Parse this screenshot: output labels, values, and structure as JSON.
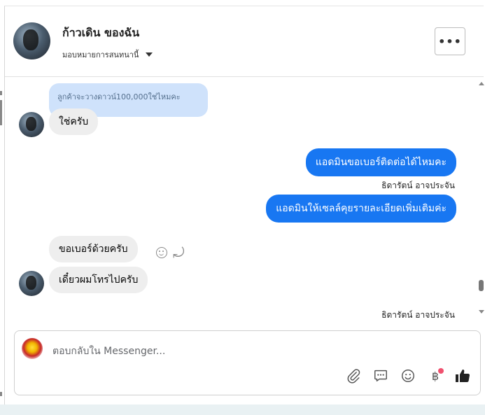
{
  "header": {
    "title": "ก้าวเดิน ของฉัน",
    "assign_label": "มอบหมายการสนทนานี้",
    "more_label": "•••"
  },
  "conversation": {
    "quoted_text": "ลูกค้าจะวางดาวน์100,000ใช่ไหมคะ",
    "messages": [
      {
        "direction": "incoming",
        "text": "ใช่ครับ"
      },
      {
        "direction": "outgoing",
        "text": "แอดมินขอเบอร์ติดต่อได้ไหมคะ"
      },
      {
        "direction": "outgoing",
        "text": "แอดมินให้เซลล์คุยรายละเอียดเพิ่มเติมค่ะ"
      },
      {
        "direction": "incoming",
        "text": "ขอเบอร์ด้วยครับ"
      },
      {
        "direction": "incoming",
        "text": "เดี๋ยวผมโทรไปครับ"
      }
    ],
    "sender_name_1": "ธิดารัตน์ อาจประจัน",
    "sender_name_2": "ธิดารัตน์ อาจประจัน"
  },
  "composer": {
    "placeholder": "ตอบกลับใน Messenger...",
    "baht_symbol": "฿",
    "tools": [
      "paperclip-icon",
      "chat-bubble-icon",
      "smile-icon",
      "baht-icon",
      "thumbs-up-icon"
    ]
  },
  "colors": {
    "outgoing_bubble": "#1877f2",
    "incoming_bubble": "#eeeeee",
    "quote_bubble": "#cfe2fb",
    "notification_dot": "#f0506e"
  }
}
